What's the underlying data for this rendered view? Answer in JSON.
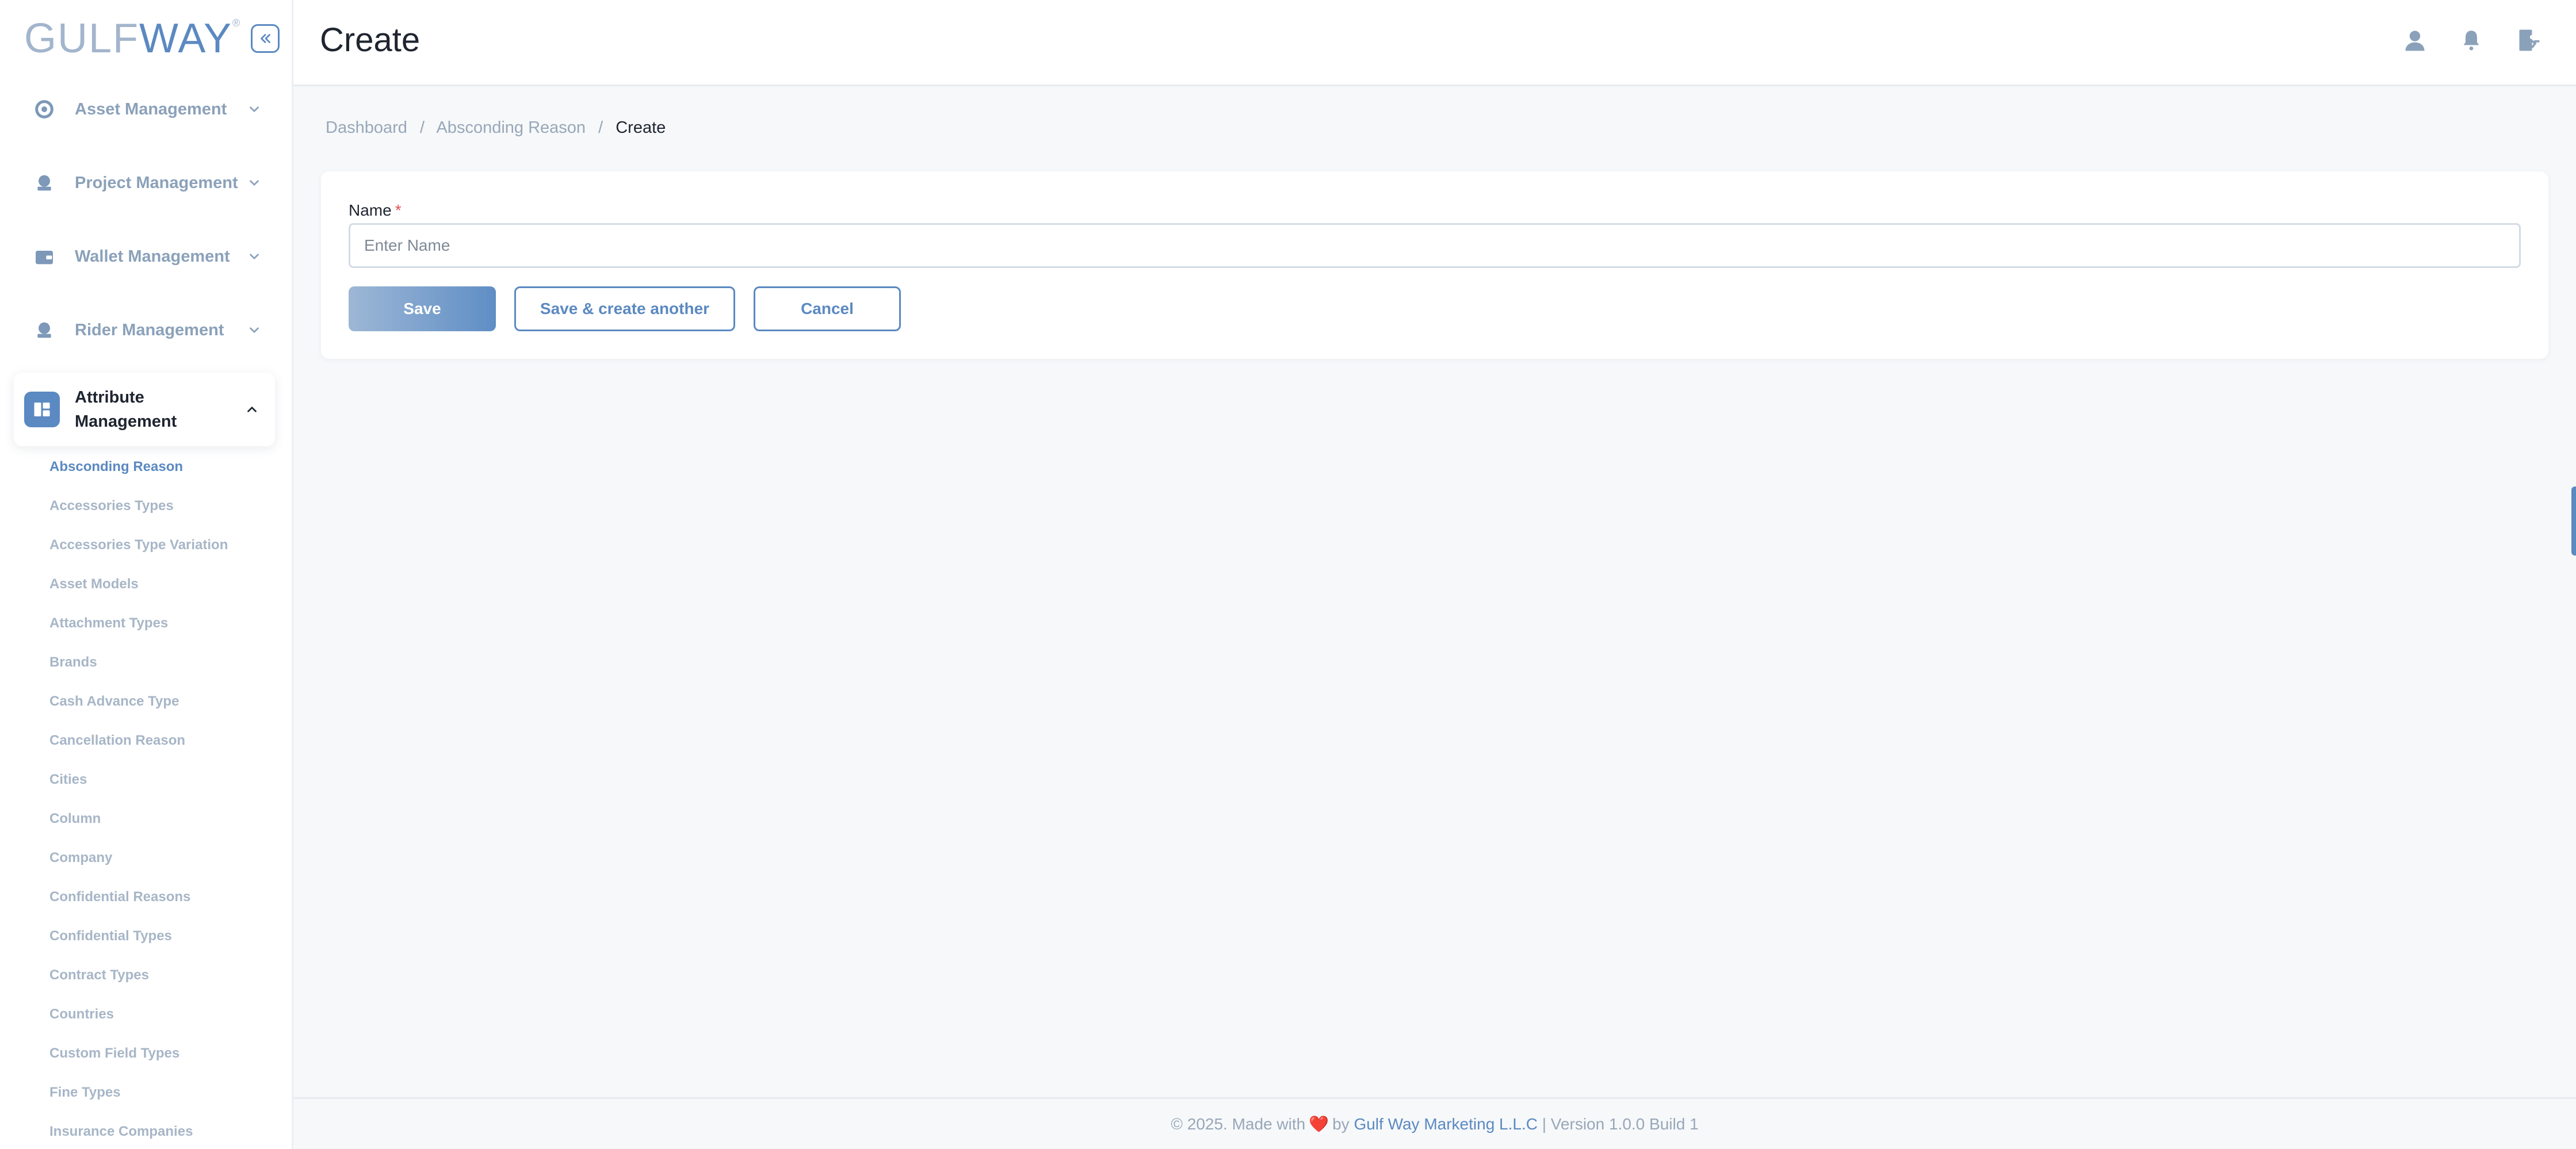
{
  "brand": {
    "logo_part1": "GULF",
    "logo_part2": "WAY",
    "logo_mark": "®"
  },
  "sidebar": {
    "groups": [
      {
        "label": "Asset Management",
        "icon": "asset-icon"
      },
      {
        "label": "Project Management",
        "icon": "project-icon"
      },
      {
        "label": "Wallet Management",
        "icon": "wallet-icon"
      },
      {
        "label": "Rider Management",
        "icon": "rider-icon"
      },
      {
        "label_line1": "Attribute",
        "label_line2": "Management",
        "icon": "attribute-icon"
      }
    ],
    "subitems": [
      "Absconding Reason",
      "Accessories Types",
      "Accessories Type Variation",
      "Asset Models",
      "Attachment Types",
      "Brands",
      "Cash Advance Type",
      "Cancellation Reason",
      "Cities",
      "Column",
      "Company",
      "Confidential Reasons",
      "Confidential Types",
      "Contract Types",
      "Countries",
      "Custom Field Types",
      "Fine Types",
      "Insurance Companies"
    ]
  },
  "header": {
    "title": "Create"
  },
  "breadcrumb": {
    "home": "Dashboard",
    "parent": "Absconding Reason",
    "current": "Create",
    "separator": "/"
  },
  "form": {
    "name_label": "Name",
    "required_mark": "*",
    "name_placeholder": "Enter Name",
    "name_value": "",
    "save_label": "Save",
    "save_another_label": "Save & create another",
    "cancel_label": "Cancel"
  },
  "footer": {
    "prefix": "© 2025. Made with",
    "heart": "❤️",
    "by": "by",
    "company": "Gulf Way Marketing L.L.C",
    "suffix": "| Version 1.0.0 Build 1"
  },
  "colors": {
    "accent": "#5b89c1",
    "muted": "#98a7b8",
    "background": "#f6f8fa"
  }
}
